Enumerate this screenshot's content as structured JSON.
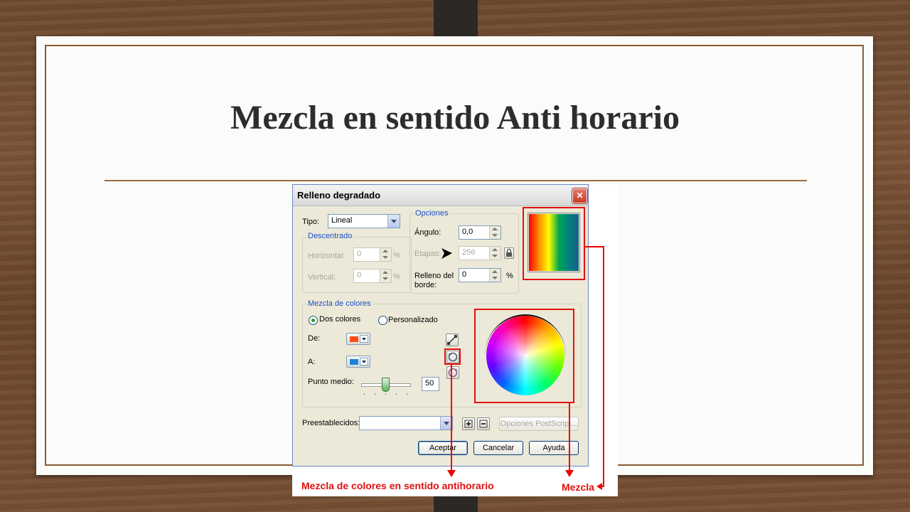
{
  "slide": {
    "title": "Mezcla en sentido Anti horario"
  },
  "dialog": {
    "title": "Relleno degradado",
    "close_glyph": "✕",
    "tipo": {
      "label": "Tipo:",
      "value": "Lineal"
    },
    "descentrado": {
      "group_title": "Descentrado",
      "horizontal_label": "Horizontal:",
      "horizontal_value": "0",
      "vertical_label": "Vertical:",
      "vertical_value": "0",
      "percent": "%"
    },
    "opciones": {
      "group_title": "Opciones",
      "angulo_label": "Ángulo:",
      "angulo_value": "0,0",
      "etapas_label": "Etapas:",
      "etapas_value": "256",
      "relleno_label_1": "Relleno del",
      "relleno_label_2": "borde:",
      "relleno_value": "0",
      "percent": "%"
    },
    "mezcla": {
      "group_title": "Mezcla de colores",
      "dos_colores": "Dos colores",
      "personalizado": "Personalizado",
      "selected": "Dos colores",
      "de_label": "De:",
      "de_color": "#ff4a1a",
      "a_label": "A:",
      "a_color": "#1b84e0",
      "punto_medio_label": "Punto medio:",
      "punto_medio_value": "50"
    },
    "preestablecidos_label": "Preestablecidos:",
    "preestablecidos_value": "",
    "opciones_postscript": "Opciones PostScript...",
    "buttons": {
      "accept": "Aceptar",
      "cancel": "Cancelar",
      "help": "Ayuda"
    },
    "preview_colors": [
      "#ff0000",
      "#ff8c00",
      "#ffff00",
      "#00a651",
      "#008080",
      "#1b5e8a"
    ]
  },
  "annotations": {
    "counterclockwise": "Mezcla de colores en sentido antihorario",
    "mix": "Mezcla"
  },
  "icons": [
    "close-icon",
    "lock-icon",
    "direct-blend-icon",
    "counterclockwise-blend-icon",
    "clockwise-blend-icon",
    "add-preset-icon",
    "remove-preset-icon",
    "mouse-cursor-icon"
  ]
}
